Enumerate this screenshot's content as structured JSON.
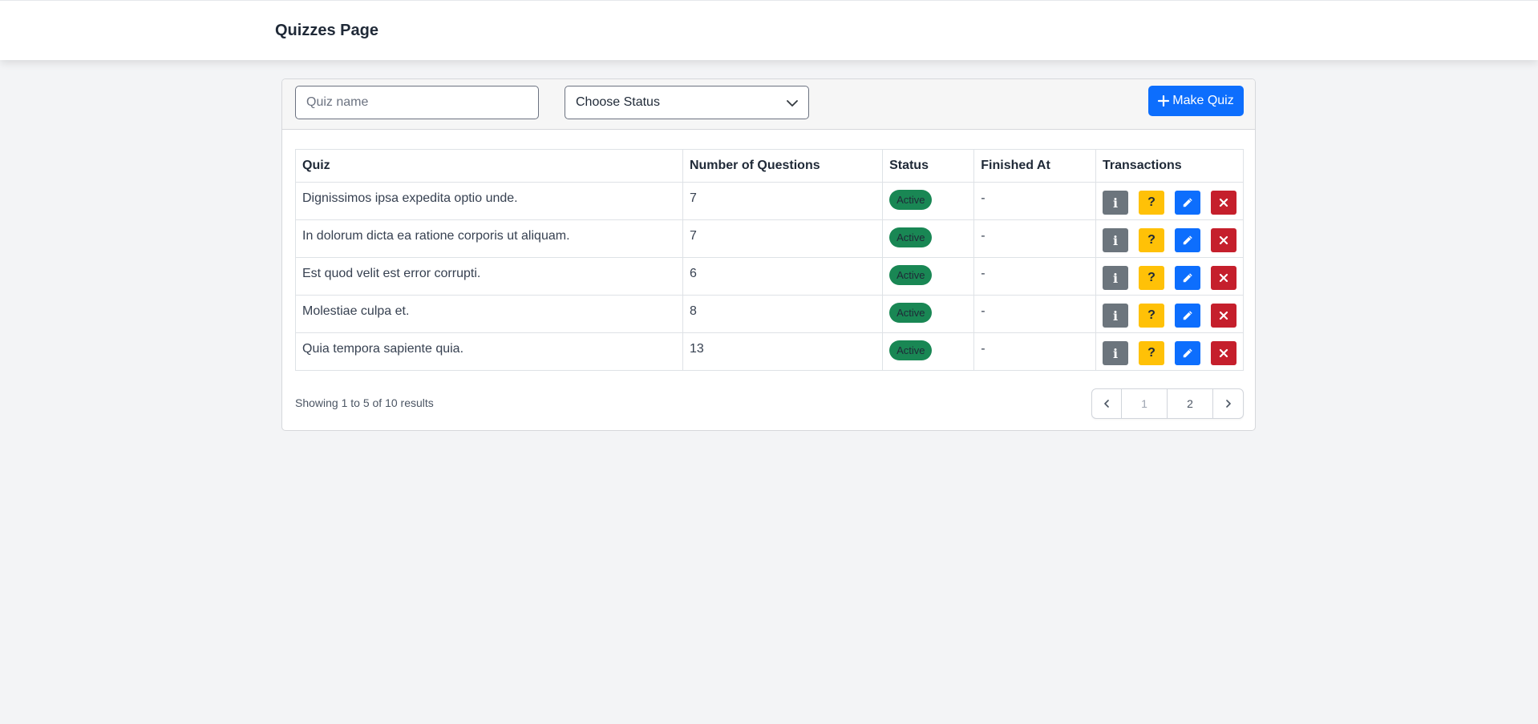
{
  "header": {
    "title": "Quizzes Page"
  },
  "filters": {
    "search_placeholder": "Quiz name",
    "status_selected": "Choose Status",
    "make_quiz_label": "Make Quiz"
  },
  "table": {
    "columns": [
      "Quiz",
      "Number of Questions",
      "Status",
      "Finished At",
      "Transactions"
    ],
    "rows": [
      {
        "quiz": "Dignissimos ipsa expedita optio unde.",
        "questions": "7",
        "status": "Active",
        "finished_at": "-"
      },
      {
        "quiz": "In dolorum dicta ea ratione corporis ut aliquam.",
        "questions": "7",
        "status": "Active",
        "finished_at": "-"
      },
      {
        "quiz": "Est quod velit est error corrupti.",
        "questions": "6",
        "status": "Active",
        "finished_at": "-"
      },
      {
        "quiz": "Molestiae culpa et.",
        "questions": "8",
        "status": "Active",
        "finished_at": "-"
      },
      {
        "quiz": "Quia tempora sapiente quia.",
        "questions": "13",
        "status": "Active",
        "finished_at": "-"
      }
    ],
    "action_icons": [
      "info-icon",
      "question-icon",
      "pencil-icon",
      "close-icon"
    ]
  },
  "pagination": {
    "summary": "Showing 1 to 5 of 10 results",
    "pages": [
      "1",
      "2"
    ],
    "current_page": "1"
  },
  "colors": {
    "primary": "#0d6efd",
    "success": "#198754",
    "warning": "#ffc107",
    "danger": "#c51f2c",
    "secondary": "#6c757d",
    "page_bg": "#f3f4f6"
  }
}
